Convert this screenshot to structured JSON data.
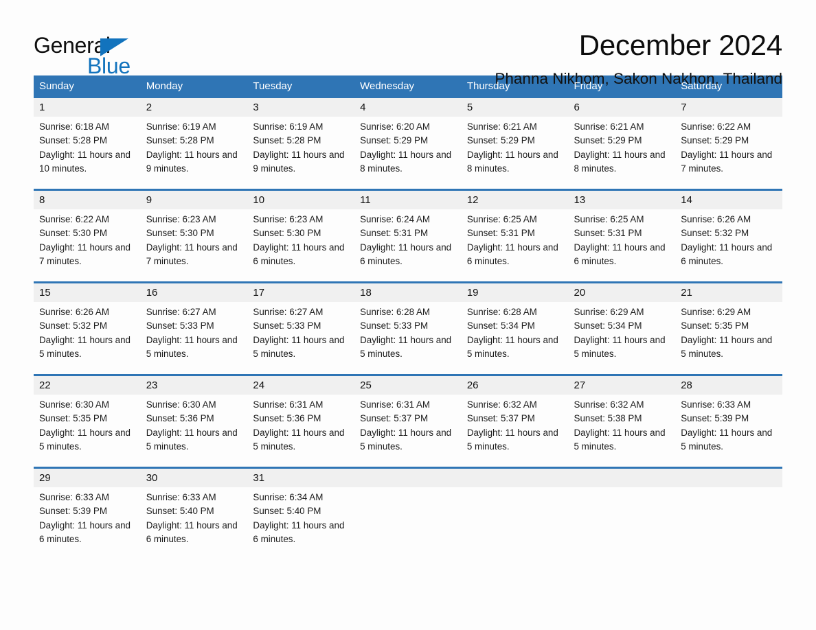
{
  "brand": {
    "name_part1": "General",
    "name_part2": "Blue",
    "accent_color": "#1273bd"
  },
  "header": {
    "title": "December 2024",
    "location": "Phanna Nikhom, Sakon Nakhon, Thailand"
  },
  "calendar": {
    "header_color": "#2f75b5",
    "day_names": [
      "Sunday",
      "Monday",
      "Tuesday",
      "Wednesday",
      "Thursday",
      "Friday",
      "Saturday"
    ],
    "weeks": [
      [
        {
          "day": "1",
          "sunrise": "Sunrise: 6:18 AM",
          "sunset": "Sunset: 5:28 PM",
          "daylight": "Daylight: 11 hours and 10 minutes."
        },
        {
          "day": "2",
          "sunrise": "Sunrise: 6:19 AM",
          "sunset": "Sunset: 5:28 PM",
          "daylight": "Daylight: 11 hours and 9 minutes."
        },
        {
          "day": "3",
          "sunrise": "Sunrise: 6:19 AM",
          "sunset": "Sunset: 5:28 PM",
          "daylight": "Daylight: 11 hours and 9 minutes."
        },
        {
          "day": "4",
          "sunrise": "Sunrise: 6:20 AM",
          "sunset": "Sunset: 5:29 PM",
          "daylight": "Daylight: 11 hours and 8 minutes."
        },
        {
          "day": "5",
          "sunrise": "Sunrise: 6:21 AM",
          "sunset": "Sunset: 5:29 PM",
          "daylight": "Daylight: 11 hours and 8 minutes."
        },
        {
          "day": "6",
          "sunrise": "Sunrise: 6:21 AM",
          "sunset": "Sunset: 5:29 PM",
          "daylight": "Daylight: 11 hours and 8 minutes."
        },
        {
          "day": "7",
          "sunrise": "Sunrise: 6:22 AM",
          "sunset": "Sunset: 5:29 PM",
          "daylight": "Daylight: 11 hours and 7 minutes."
        }
      ],
      [
        {
          "day": "8",
          "sunrise": "Sunrise: 6:22 AM",
          "sunset": "Sunset: 5:30 PM",
          "daylight": "Daylight: 11 hours and 7 minutes."
        },
        {
          "day": "9",
          "sunrise": "Sunrise: 6:23 AM",
          "sunset": "Sunset: 5:30 PM",
          "daylight": "Daylight: 11 hours and 7 minutes."
        },
        {
          "day": "10",
          "sunrise": "Sunrise: 6:23 AM",
          "sunset": "Sunset: 5:30 PM",
          "daylight": "Daylight: 11 hours and 6 minutes."
        },
        {
          "day": "11",
          "sunrise": "Sunrise: 6:24 AM",
          "sunset": "Sunset: 5:31 PM",
          "daylight": "Daylight: 11 hours and 6 minutes."
        },
        {
          "day": "12",
          "sunrise": "Sunrise: 6:25 AM",
          "sunset": "Sunset: 5:31 PM",
          "daylight": "Daylight: 11 hours and 6 minutes."
        },
        {
          "day": "13",
          "sunrise": "Sunrise: 6:25 AM",
          "sunset": "Sunset: 5:31 PM",
          "daylight": "Daylight: 11 hours and 6 minutes."
        },
        {
          "day": "14",
          "sunrise": "Sunrise: 6:26 AM",
          "sunset": "Sunset: 5:32 PM",
          "daylight": "Daylight: 11 hours and 6 minutes."
        }
      ],
      [
        {
          "day": "15",
          "sunrise": "Sunrise: 6:26 AM",
          "sunset": "Sunset: 5:32 PM",
          "daylight": "Daylight: 11 hours and 5 minutes."
        },
        {
          "day": "16",
          "sunrise": "Sunrise: 6:27 AM",
          "sunset": "Sunset: 5:33 PM",
          "daylight": "Daylight: 11 hours and 5 minutes."
        },
        {
          "day": "17",
          "sunrise": "Sunrise: 6:27 AM",
          "sunset": "Sunset: 5:33 PM",
          "daylight": "Daylight: 11 hours and 5 minutes."
        },
        {
          "day": "18",
          "sunrise": "Sunrise: 6:28 AM",
          "sunset": "Sunset: 5:33 PM",
          "daylight": "Daylight: 11 hours and 5 minutes."
        },
        {
          "day": "19",
          "sunrise": "Sunrise: 6:28 AM",
          "sunset": "Sunset: 5:34 PM",
          "daylight": "Daylight: 11 hours and 5 minutes."
        },
        {
          "day": "20",
          "sunrise": "Sunrise: 6:29 AM",
          "sunset": "Sunset: 5:34 PM",
          "daylight": "Daylight: 11 hours and 5 minutes."
        },
        {
          "day": "21",
          "sunrise": "Sunrise: 6:29 AM",
          "sunset": "Sunset: 5:35 PM",
          "daylight": "Daylight: 11 hours and 5 minutes."
        }
      ],
      [
        {
          "day": "22",
          "sunrise": "Sunrise: 6:30 AM",
          "sunset": "Sunset: 5:35 PM",
          "daylight": "Daylight: 11 hours and 5 minutes."
        },
        {
          "day": "23",
          "sunrise": "Sunrise: 6:30 AM",
          "sunset": "Sunset: 5:36 PM",
          "daylight": "Daylight: 11 hours and 5 minutes."
        },
        {
          "day": "24",
          "sunrise": "Sunrise: 6:31 AM",
          "sunset": "Sunset: 5:36 PM",
          "daylight": "Daylight: 11 hours and 5 minutes."
        },
        {
          "day": "25",
          "sunrise": "Sunrise: 6:31 AM",
          "sunset": "Sunset: 5:37 PM",
          "daylight": "Daylight: 11 hours and 5 minutes."
        },
        {
          "day": "26",
          "sunrise": "Sunrise: 6:32 AM",
          "sunset": "Sunset: 5:37 PM",
          "daylight": "Daylight: 11 hours and 5 minutes."
        },
        {
          "day": "27",
          "sunrise": "Sunrise: 6:32 AM",
          "sunset": "Sunset: 5:38 PM",
          "daylight": "Daylight: 11 hours and 5 minutes."
        },
        {
          "day": "28",
          "sunrise": "Sunrise: 6:33 AM",
          "sunset": "Sunset: 5:39 PM",
          "daylight": "Daylight: 11 hours and 5 minutes."
        }
      ],
      [
        {
          "day": "29",
          "sunrise": "Sunrise: 6:33 AM",
          "sunset": "Sunset: 5:39 PM",
          "daylight": "Daylight: 11 hours and 6 minutes."
        },
        {
          "day": "30",
          "sunrise": "Sunrise: 6:33 AM",
          "sunset": "Sunset: 5:40 PM",
          "daylight": "Daylight: 11 hours and 6 minutes."
        },
        {
          "day": "31",
          "sunrise": "Sunrise: 6:34 AM",
          "sunset": "Sunset: 5:40 PM",
          "daylight": "Daylight: 11 hours and 6 minutes."
        },
        {
          "day": "",
          "sunrise": "",
          "sunset": "",
          "daylight": ""
        },
        {
          "day": "",
          "sunrise": "",
          "sunset": "",
          "daylight": ""
        },
        {
          "day": "",
          "sunrise": "",
          "sunset": "",
          "daylight": ""
        },
        {
          "day": "",
          "sunrise": "",
          "sunset": "",
          "daylight": ""
        }
      ]
    ]
  }
}
